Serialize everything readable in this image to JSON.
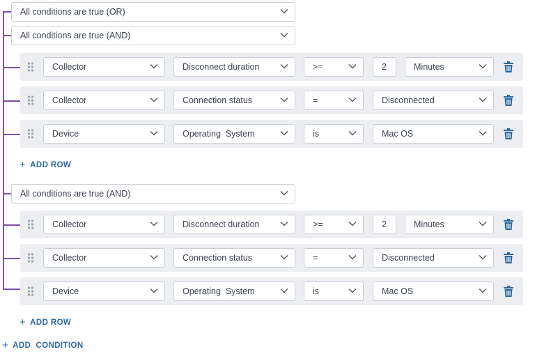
{
  "top_group": {
    "operator": "All conditions are true (OR)"
  },
  "groups": [
    {
      "operator": "All conditions are true (AND)",
      "add_row_label": "ADD ROW",
      "rows": [
        {
          "entity": "Collector",
          "attribute": "Disconnect duration",
          "comparator": ">=",
          "value": "2",
          "unit": "Minutes"
        },
        {
          "entity": "Collector",
          "attribute": "Connection status",
          "comparator": "=",
          "value": "Disconnected"
        },
        {
          "entity": "Device",
          "attribute": "Operating  System",
          "comparator": "is",
          "value": "Mac OS"
        }
      ]
    },
    {
      "operator": "All conditions are true (AND)",
      "add_row_label": "ADD ROW",
      "rows": [
        {
          "entity": "Collector",
          "attribute": "Disconnect duration",
          "comparator": ">=",
          "value": "2",
          "unit": "Minutes"
        },
        {
          "entity": "Collector",
          "attribute": "Connection status",
          "comparator": "=",
          "value": "Disconnected"
        },
        {
          "entity": "Device",
          "attribute": "Operating  System",
          "comparator": "is",
          "value": "Mac OS"
        }
      ]
    }
  ],
  "add_condition_label": "ADD  CONDITION",
  "icons": {
    "drag": "drag-handle-icon",
    "delete": "trash-icon",
    "expand": "chevron-down-icon",
    "add": "plus-icon"
  },
  "colors": {
    "tree_line": "#7b4fa8",
    "link": "#2c6aa0",
    "delete_icon": "#2c6aa0",
    "row_background": "#eceef2"
  }
}
